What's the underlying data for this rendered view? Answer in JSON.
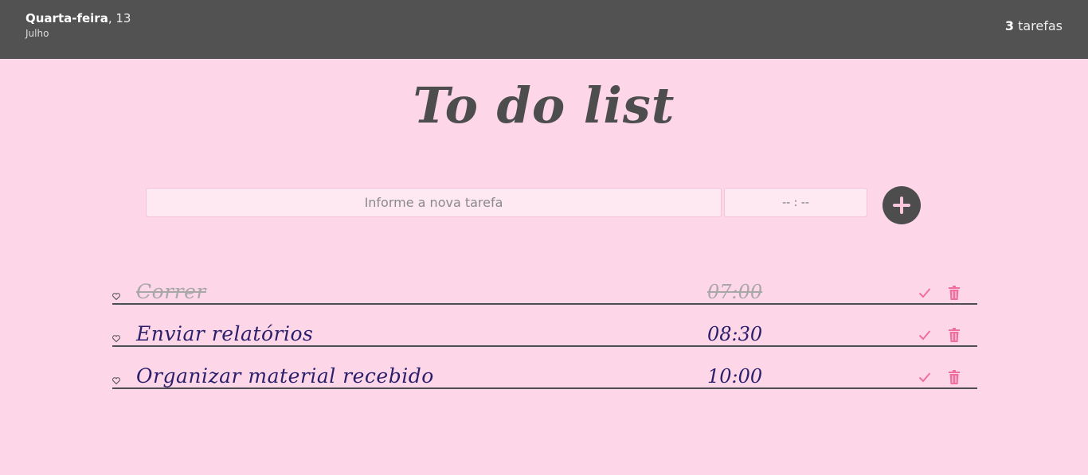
{
  "header": {
    "weekday": "Quarta-feira",
    "day": ", 13",
    "month": "Julho",
    "task_count": "3",
    "task_count_label": " tarefas"
  },
  "title": "To do list",
  "form": {
    "task_placeholder": "Informe a nova tarefa",
    "time_placeholder": "-- : --",
    "add_icon": "plus-icon"
  },
  "tasks": [
    {
      "text": "Correr",
      "time": "07:00",
      "done": true
    },
    {
      "text": "Enviar relatórios",
      "time": "08:30",
      "done": false
    },
    {
      "text": "Organizar material recebido",
      "time": "10:00",
      "done": false
    }
  ],
  "icons": {
    "item": "heart-icon",
    "complete": "check-icon",
    "delete": "trash-icon"
  },
  "colors": {
    "background": "#fdd6e8",
    "header": "#525252",
    "accent": "#ef6f9f",
    "task_text": "#2a1f6b",
    "done_text": "#a8a8a8"
  }
}
